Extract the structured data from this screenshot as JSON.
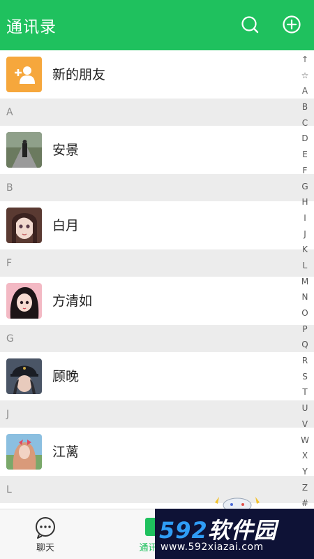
{
  "header": {
    "title": "通讯录",
    "search_icon": "search-icon",
    "add_icon": "plus-circle-icon"
  },
  "new_friends": {
    "label": "新的朋友",
    "icon": "add-person-icon",
    "color": "#f6a73c"
  },
  "sections": [
    {
      "letter": "A",
      "contact": "安景"
    },
    {
      "letter": "B",
      "contact": "白月"
    },
    {
      "letter": "F",
      "contact": "方清如"
    },
    {
      "letter": "G",
      "contact": "顾晚"
    },
    {
      "letter": "J",
      "contact": "江蓠"
    },
    {
      "letter": "L",
      "contact": ""
    }
  ],
  "index_bar": [
    "↑",
    "☆",
    "A",
    "B",
    "C",
    "D",
    "E",
    "F",
    "G",
    "H",
    "I",
    "J",
    "K",
    "L",
    "M",
    "N",
    "O",
    "P",
    "Q",
    "R",
    "S",
    "T",
    "U",
    "V",
    "W",
    "X",
    "Y",
    "Z",
    "#"
  ],
  "tabbar": {
    "chat_label": "聊天",
    "contacts_label": "通讯录"
  },
  "watermark": {
    "brand_num": "592",
    "brand_text": "软件园",
    "url": "www.592xiazai.com"
  },
  "colors": {
    "accent": "#1fc15e",
    "section_bg": "#ececec",
    "watermark_bg": "#0e1236"
  }
}
